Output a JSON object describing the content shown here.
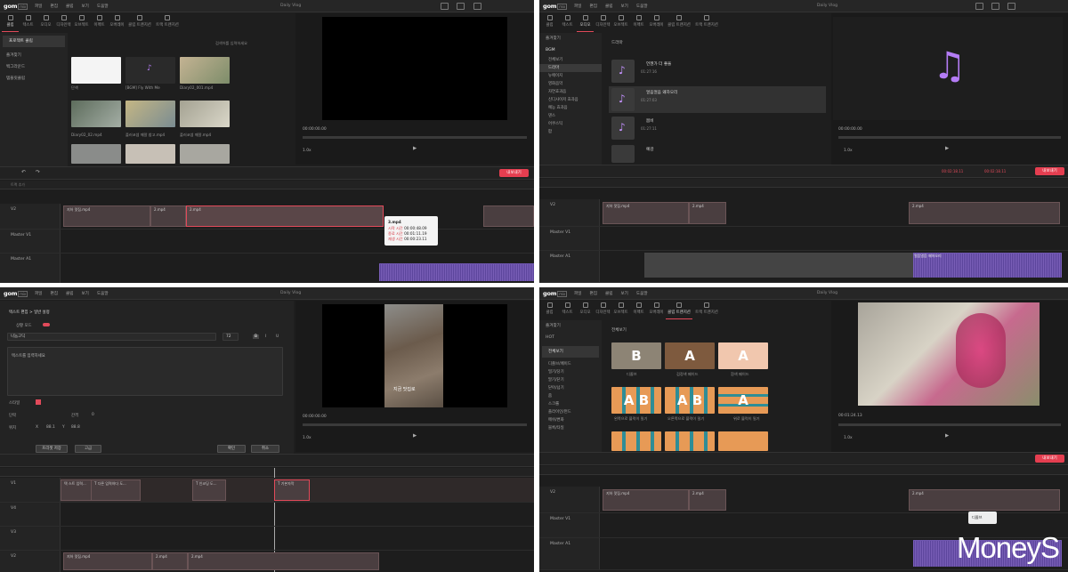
{
  "app": {
    "logo": "gom",
    "logo_sub": "mix",
    "title": "Daily Vlog",
    "menu": [
      "파일",
      "편집",
      "클립",
      "보기",
      "도움말"
    ]
  },
  "tabs": {
    "p1": [
      "클립",
      "텍스트",
      "오디오",
      "디자인텍",
      "오브젝트",
      "이펙트",
      "오버레이",
      "클립 트랜지션",
      "트랙 트랜지션"
    ],
    "p2": [
      "클립",
      "텍스트",
      "오디오",
      "디자인텍",
      "오브젝트",
      "이펙트",
      "오버레이",
      "클립 트랜지션",
      "트랙 트랜지션"
    ],
    "p4": [
      "클립",
      "텍스트",
      "오디오",
      "디자인텍",
      "오브젝트",
      "이펙트",
      "오버레이",
      "클립 트랜지션",
      "트랙 트랜지션"
    ]
  },
  "p1": {
    "sidebar": [
      "프로젝트 클립",
      "즐겨찾기",
      "백그라운드",
      "템플릿클립"
    ],
    "search_placeholder": "검색어를 입력하세요",
    "thumbs": [
      {
        "cap": "단색",
        "color": "#f4f4f4"
      },
      {
        "cap": "[BGM] Fly With Me",
        "color": "#2a2a2a"
      },
      {
        "cap": "Diary02_001.mp4",
        "color": "#8a9a7c"
      },
      {
        "cap": "Diary02_02.mp4",
        "color": "#7f8b83"
      },
      {
        "cap": "플러코셈 깨알 참고.mp4",
        "color": "#b4a88c"
      },
      {
        "cap": "플러코셈 깨알.mp4",
        "color": "#a7a499"
      }
    ],
    "timecode": "00:00:00.00",
    "zoom": "1.0x",
    "export": "내보내기",
    "tracks": [
      "V2",
      "Master V1",
      "Master A1"
    ],
    "ruler_label": "트랙 추가",
    "clips": [
      "지하 맛집.mp4",
      "2.mp4",
      "2.mp4"
    ],
    "tooltip": {
      "file": "3.mp4",
      "rows": [
        {
          "k": "시작 시간",
          "v": "00:00:48.09"
        },
        {
          "k": "종료 시간",
          "v": "00:01:11.19"
        },
        {
          "k": "재생 시간",
          "v": "00:00:23.11"
        }
      ]
    }
  },
  "p2": {
    "fav": "즐겨찾기",
    "bgm": "BGM",
    "cats": [
      "전체보기",
      "드라마",
      "뉴에이지",
      "영화음악",
      "자연효과음",
      "신디사이저 효과음",
      "예능 효과음",
      "댄스",
      "어쿠스틱",
      "팝"
    ],
    "list_title": "드라마",
    "songs": [
      {
        "title": "언젠가 더 좋을",
        "time": "01:27:16"
      },
      {
        "title": "얼음얼음 왜하오리",
        "time": "01:27:03"
      },
      {
        "title": "봄비",
        "time": "01:27:11"
      },
      {
        "title": "예감",
        "time": ""
      }
    ],
    "timecode": "00:00:00.00",
    "zoom": "1.0x",
    "timecodes": [
      "00:02:18.11",
      "00:02:18.11"
    ],
    "export": "내보내기",
    "tracks": [
      "V2",
      "Master V1",
      "Master A1"
    ],
    "clips": [
      "지하 맛집.mp4",
      "2.mp4",
      "2.mp4"
    ],
    "audio": "얼음얼음 왜하오리"
  },
  "p3": {
    "breadcrumb": "텍스트 편집 > 일반 설정",
    "toggle": "상황 모드",
    "font": "나눔고딕",
    "size": "72",
    "text_placeholder": "텍스트를 입력하세요",
    "labels": [
      "스타일",
      "단락",
      "위치"
    ],
    "gap": "간격",
    "gap_value": "0",
    "pos_x": "X",
    "pos_x_val": "88.1",
    "pos_y": "Y",
    "pos_y_val": "88.8",
    "buttons": [
      "프리셋 저장",
      "고급",
      "확인",
      "취소"
    ],
    "caption": "지금 맛집로",
    "timecode": "00:00:00.00",
    "zoom": "1.0x",
    "tracks": [
      "V1",
      "V4",
      "V3",
      "V2"
    ],
    "text_clips": [
      "텍 스트 입력...",
      "T 다른 입력하다 도...",
      "T 인코딩 도...",
      "T 기본자막"
    ],
    "clips": [
      "지하 맛집.mp4",
      "2.mp4",
      "2.mp4"
    ]
  },
  "p4": {
    "fav": "즐겨찾기",
    "hot": "HOT",
    "all": "전체보기",
    "cats": [
      "디졸브/페이드",
      "밀기/당기",
      "말기/닫기",
      "닫아/넘기",
      "줌",
      "스크롤",
      "플라이인/펀드",
      "메쉬/변화",
      "블록/타일"
    ],
    "grid_title": "전체보기",
    "cards": [
      {
        "label": "디졸브",
        "text": "B",
        "bg": "#8d8475"
      },
      {
        "label": "검정색 페이드",
        "text": "A",
        "bg": "#7e5a3e"
      },
      {
        "label": "흰색 페이드",
        "text": "A",
        "bg": "#f1c7ae"
      },
      {
        "label": "왼쪽으로 블럭이 밀기",
        "text": "A B",
        "bg": "#e79a56"
      },
      {
        "label": "오른쪽으로 블럭이 밀기",
        "text": "A B",
        "bg": "#e79a56"
      },
      {
        "label": "위로 블럭이 밀기",
        "text": "A",
        "bg": "#e79a56"
      },
      {
        "label": "",
        "text": "",
        "bg": "#e79a56"
      },
      {
        "label": "",
        "text": "",
        "bg": "#e79a56"
      },
      {
        "label": "",
        "text": "",
        "bg": "#e79a56"
      }
    ],
    "timecode": "00:01:24.13",
    "zoom": "1.0x",
    "export": "내보내기",
    "tracks": [
      "V2",
      "Master V1",
      "Master A1"
    ],
    "clips": [
      "지하 맛집.mp4",
      "2.mp4",
      "2.mp4"
    ],
    "menu_popup": "디졸브",
    "watermark": "MoneyS"
  }
}
